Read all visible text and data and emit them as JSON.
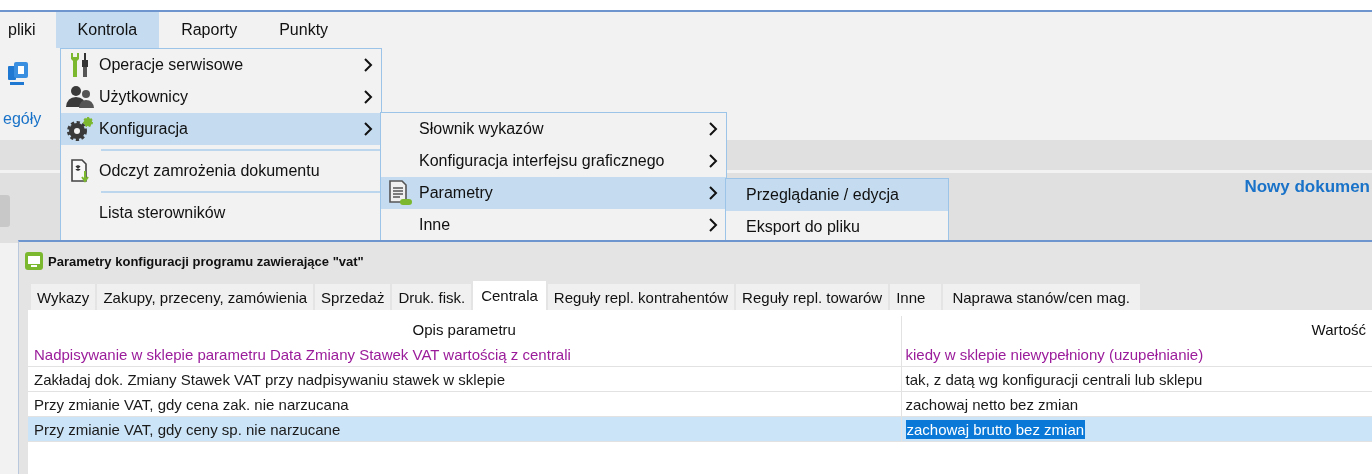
{
  "menubar": [
    {
      "label": "pliki",
      "selected": false
    },
    {
      "label": "Kontrola",
      "selected": true
    },
    {
      "label": "Raporty",
      "selected": false
    },
    {
      "label": "Punkty",
      "selected": false
    }
  ],
  "ribbon": {
    "button_label": "egóły"
  },
  "panel": {
    "title": "Nowy dokumen"
  },
  "menus": [
    {
      "items": [
        {
          "kind": "item",
          "label": "Operacje serwisowe",
          "has_submenu": true,
          "selected": false
        },
        {
          "kind": "item",
          "label": "Użytkownicy",
          "has_submenu": true,
          "selected": false
        },
        {
          "kind": "item",
          "label": "Konfiguracja",
          "has_submenu": true,
          "selected": true
        },
        {
          "kind": "separator"
        },
        {
          "kind": "item",
          "label": "Odczyt zamrożenia dokumentu",
          "has_submenu": false,
          "selected": false
        },
        {
          "kind": "separator"
        },
        {
          "kind": "item",
          "label": "Lista sterowników",
          "has_submenu": false,
          "selected": false
        }
      ]
    },
    {
      "items": [
        {
          "kind": "item",
          "label": "Słownik wykazów",
          "has_submenu": true,
          "selected": false
        },
        {
          "kind": "item",
          "label": "Konfiguracja interfejsu graficznego",
          "has_submenu": true,
          "selected": false
        },
        {
          "kind": "item",
          "label": "Parametry",
          "has_submenu": true,
          "selected": true
        },
        {
          "kind": "item",
          "label": "Inne",
          "has_submenu": true,
          "selected": false
        }
      ]
    },
    {
      "items": [
        {
          "kind": "item",
          "label": "Przeglądanie / edycja",
          "has_submenu": false,
          "selected": true
        },
        {
          "kind": "item",
          "label": "Eksport do pliku",
          "has_submenu": false,
          "selected": false
        }
      ]
    }
  ],
  "dialog": {
    "title": "Parametry konfiguracji programu zawierające \"vat\"",
    "tabs": [
      {
        "label": "Wykazy",
        "selected": false
      },
      {
        "label": "Zakupy, przeceny, zamówienia",
        "selected": false
      },
      {
        "label": "Sprzedaż",
        "selected": false
      },
      {
        "label": "Druk. fisk.",
        "selected": false
      },
      {
        "label": "Centrala",
        "selected": true
      },
      {
        "label": "Reguły repl. kontrahentów",
        "selected": false
      },
      {
        "label": "Reguły repl. towarów",
        "selected": false
      },
      {
        "label": "Inne",
        "selected": false
      },
      {
        "label": "Naprawa stanów/cen mag.",
        "selected": false
      }
    ],
    "table": {
      "columns": [
        "Opis parametru",
        "Wartość"
      ],
      "rows": [
        {
          "description": "Nadpisywanie w sklepie parametru Data Zmiany Stawek VAT wartością z centrali",
          "value": "kiedy w sklepie niewypełniony (uzupełnianie)",
          "color": "#9b1c9b",
          "selected": false
        },
        {
          "description": "Zakładaj dok. Zmiany Stawek VAT przy nadpisywaniu stawek w sklepie",
          "value": "tak, z datą wg konfiguracji centrali lub sklepu",
          "color": "#1a1a1a",
          "selected": false
        },
        {
          "description": "Przy zmianie VAT, gdy cena zak. nie narzucana",
          "value": "zachowaj netto bez zmian",
          "color": "#1a1a1a",
          "selected": false
        },
        {
          "description": "Przy zmianie VAT, gdy ceny sp. nie narzucane",
          "value": "zachowaj brutto bez zmian",
          "color": "#1a1a1a",
          "selected": true
        }
      ]
    }
  }
}
